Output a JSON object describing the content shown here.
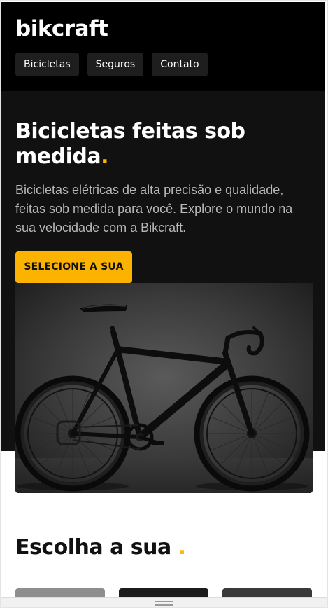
{
  "brand": {
    "logo_text": "bikcraft",
    "accent_color": "#fbb300"
  },
  "nav": {
    "items": [
      {
        "label": "Bicicletas"
      },
      {
        "label": "Seguros"
      },
      {
        "label": "Contato"
      }
    ]
  },
  "hero": {
    "title": "Bicicletas feitas sob medida",
    "title_dot": ".",
    "description": "Bicicletas elétricas de alta precisão e qualidade, feitas sob medida para você. Explore o mundo na sua velocidade com a Bikcraft.",
    "cta_label": "SELECIONE A SUA",
    "image_icon": "road-bike-image"
  },
  "choose": {
    "title": "Escolha a sua",
    "title_dot": "."
  },
  "bottom_bar": {
    "icon": "drag-handle-icon"
  }
}
